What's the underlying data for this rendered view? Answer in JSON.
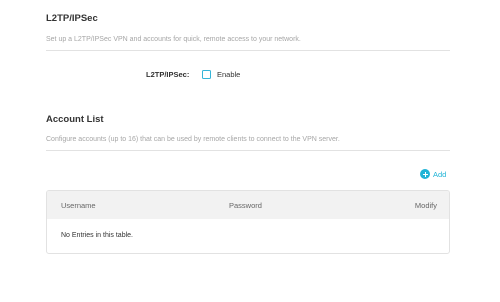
{
  "l2tp_section": {
    "title": "L2TP/IPSec",
    "description": "Set up a L2TP/IPSec VPN and accounts for quick, remote access to your network.",
    "field_label": "L2TP/IPSec:",
    "enable_label": "Enable",
    "enabled": false
  },
  "account_section": {
    "title": "Account List",
    "description": "Configure accounts (up to 16) that can be used by remote clients to connect to the VPN server.",
    "add_label": "Add",
    "columns": [
      "Username",
      "Password",
      "Modify"
    ],
    "empty_message": "No Entries in this table."
  },
  "colors": {
    "accent": "#1fb3d6",
    "heading": "#333333",
    "muted": "#a6a6a6",
    "table_header_bg": "#f2f2f2",
    "border": "#e2e2e2"
  },
  "icons": {
    "add": "plus-circle-icon"
  }
}
